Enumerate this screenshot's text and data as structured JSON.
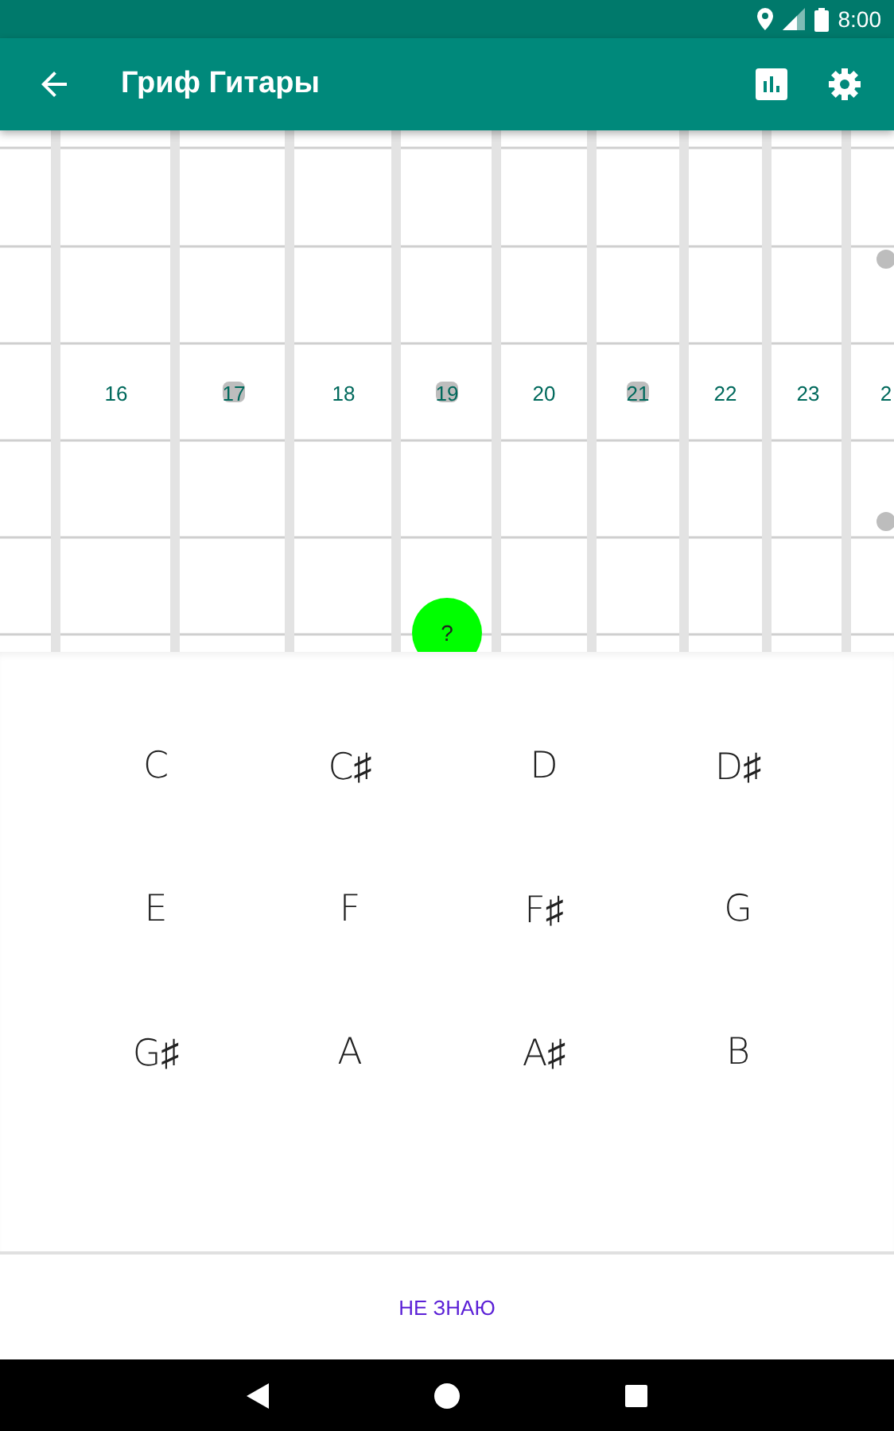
{
  "status_bar": {
    "time": "8:00"
  },
  "app_bar": {
    "title": "Гриф Гитары"
  },
  "fretboard": {
    "frets": [
      {
        "label": "16",
        "inlay": false
      },
      {
        "label": "17",
        "inlay": true
      },
      {
        "label": "18",
        "inlay": false
      },
      {
        "label": "19",
        "inlay": true
      },
      {
        "label": "20",
        "inlay": false
      },
      {
        "label": "21",
        "inlay": true
      },
      {
        "label": "22",
        "inlay": false
      },
      {
        "label": "23",
        "inlay": false
      },
      {
        "label": "2",
        "inlay": false
      }
    ],
    "edge_double_inlay": true,
    "question_marker": {
      "label": "?",
      "color": "#00ff00"
    }
  },
  "notes": [
    "C",
    "C♯",
    "D",
    "D♯",
    "E",
    "F",
    "F♯",
    "G",
    "G♯",
    "A",
    "A♯",
    "B"
  ],
  "dont_know_button": {
    "label": "НЕ ЗНАЮ"
  }
}
